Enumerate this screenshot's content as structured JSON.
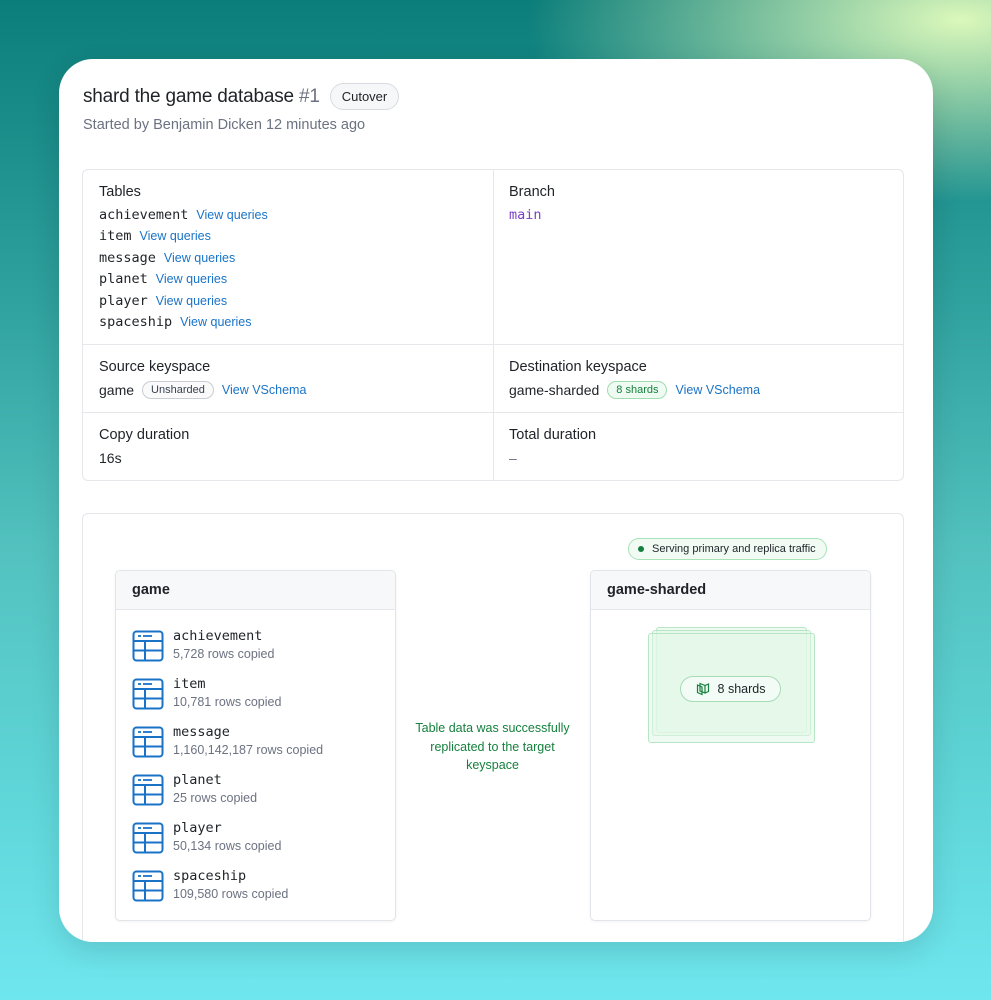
{
  "header": {
    "title": "shard the game database",
    "number": "#1",
    "badge": "Cutover",
    "subtitle": "Started by Benjamin Dicken 12 minutes ago"
  },
  "info": {
    "tables": {
      "label": "Tables",
      "items": [
        {
          "name": "achievement",
          "link": "View queries"
        },
        {
          "name": "item",
          "link": "View queries"
        },
        {
          "name": "message",
          "link": "View queries"
        },
        {
          "name": "planet",
          "link": "View queries"
        },
        {
          "name": "player",
          "link": "View queries"
        },
        {
          "name": "spaceship",
          "link": "View queries"
        }
      ]
    },
    "branch": {
      "label": "Branch",
      "value": "main"
    },
    "source": {
      "label": "Source keyspace",
      "value": "game",
      "badge": "Unsharded",
      "link": "View VSchema"
    },
    "destination": {
      "label": "Destination keyspace",
      "value": "game-sharded",
      "badge": "8 shards",
      "link": "View VSchema"
    },
    "copy_duration": {
      "label": "Copy duration",
      "value": "16s"
    },
    "total_duration": {
      "label": "Total duration",
      "value": "–"
    }
  },
  "diagram": {
    "status": "Serving primary and replica traffic",
    "source_panel": {
      "title": "game",
      "tables": [
        {
          "name": "achievement",
          "rows": "5,728 rows copied"
        },
        {
          "name": "item",
          "rows": "10,781 rows copied"
        },
        {
          "name": "message",
          "rows": "1,160,142,187 rows copied"
        },
        {
          "name": "planet",
          "rows": "25 rows copied"
        },
        {
          "name": "player",
          "rows": "50,134 rows copied"
        },
        {
          "name": "spaceship",
          "rows": "109,580 rows copied"
        }
      ]
    },
    "message": "Table data was successfully replicated to the target keyspace",
    "dest_panel": {
      "title": "game-sharded",
      "shards": "8 shards"
    },
    "colors": {
      "accent_green": "#15803d",
      "link_blue": "#1a73c7",
      "branch_purple": "#7b3fc4"
    },
    "icons": [
      "table-icon",
      "shards-icon",
      "status-dot-icon"
    ]
  }
}
